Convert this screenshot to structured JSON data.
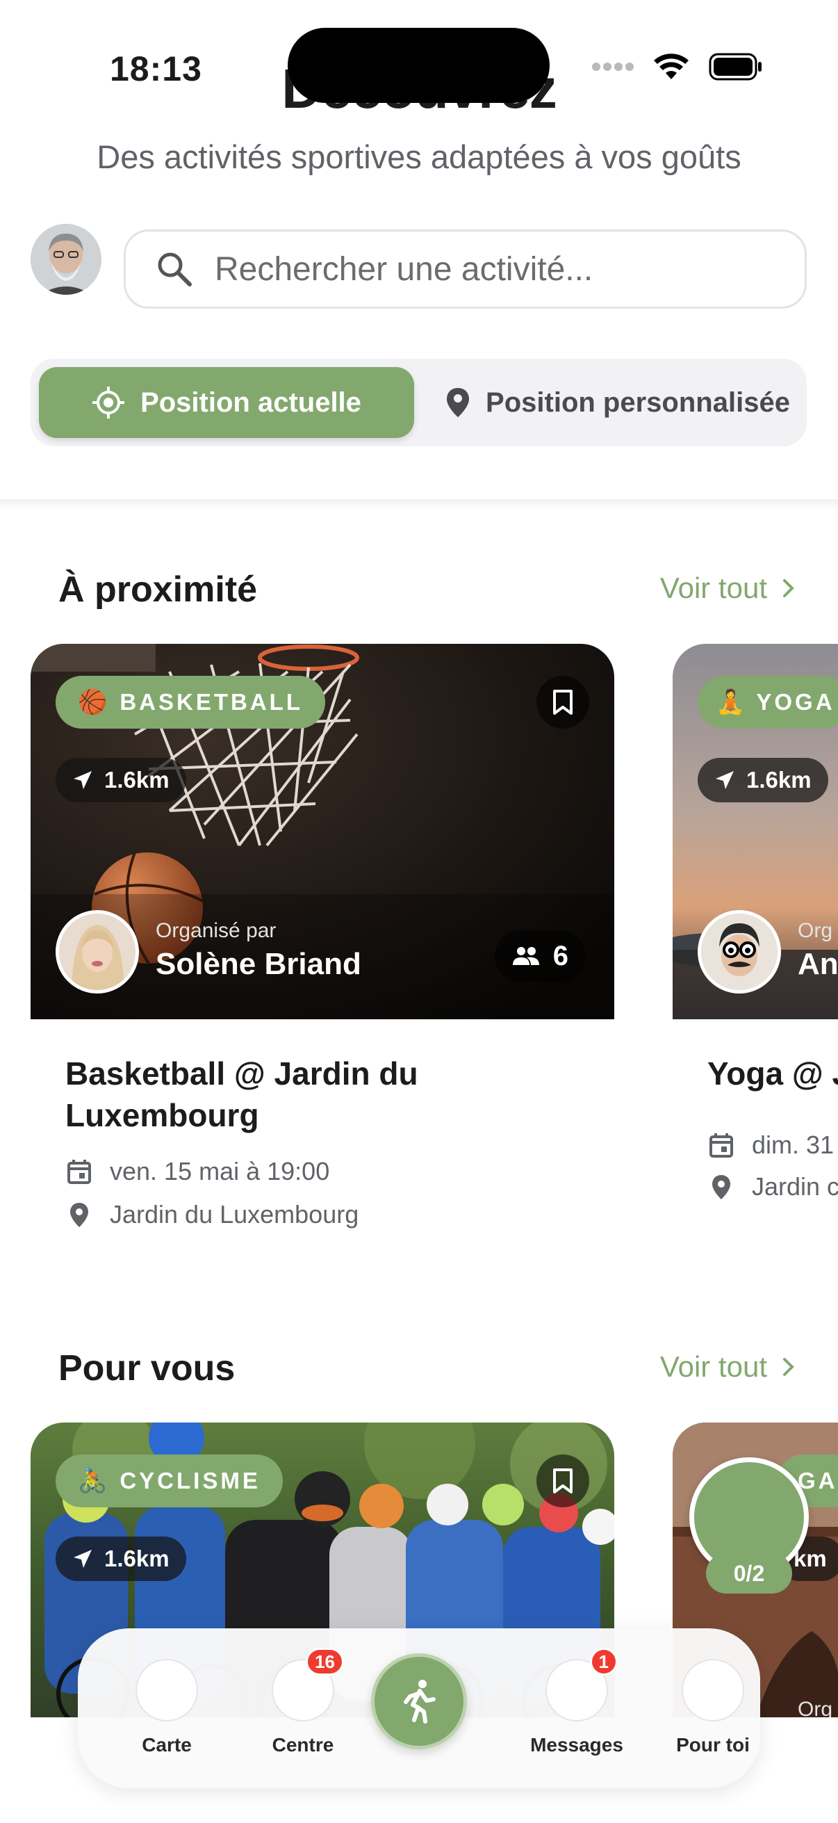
{
  "status_bar": {
    "time": "18:13"
  },
  "header": {
    "title": "Découvrez",
    "subtitle": "Des activités sportives adaptées à vos goûts"
  },
  "search": {
    "placeholder": "Rechercher une activité..."
  },
  "location_toggle": {
    "current_label": "Position actuelle",
    "custom_label": "Position personnalisée",
    "selected": "Position actuelle"
  },
  "sections": {
    "nearby": {
      "title": "À proximité",
      "see_all": "Voir tout",
      "cards": [
        {
          "tag": "BASKETBALL",
          "tag_emoji": "🏀",
          "distance": "1.6km",
          "organizer_label": "Organisé par",
          "organizer_name": "Solène Briand",
          "participants": "6",
          "title": "Basketball @ Jardin du Luxembourg",
          "date": "ven. 15 mai à 19:00",
          "location": "Jardin du Luxembourg"
        },
        {
          "tag": "YOGA",
          "tag_emoji": "🧘",
          "distance": "1.6km",
          "organizer_label": "Org",
          "organizer_name": "An",
          "title": "Yoga @ J",
          "date": "dim. 31",
          "location": "Jardin c"
        }
      ]
    },
    "for_you": {
      "title": "Pour vous",
      "see_all": "Voir tout",
      "cards": [
        {
          "tag": "CYCLISME",
          "tag_emoji": "🚴",
          "distance": "1.6km"
        },
        {
          "tag": "GA",
          "distance": "km",
          "organizer_label": "Org"
        }
      ]
    }
  },
  "progress": {
    "label": "0/2",
    "completed": 0,
    "total": 2
  },
  "bottom_nav": {
    "items": [
      {
        "label": "Carte"
      },
      {
        "label": "Centre",
        "badge": "16"
      },
      {
        "label": "Messages",
        "badge": "1"
      },
      {
        "label": "Pour toi"
      }
    ],
    "center_icon": "running-person-icon"
  },
  "colors": {
    "accent": "#82a86e",
    "badge": "#ef3b2f",
    "text": "#1c1c1e",
    "muted": "#5f6368"
  }
}
